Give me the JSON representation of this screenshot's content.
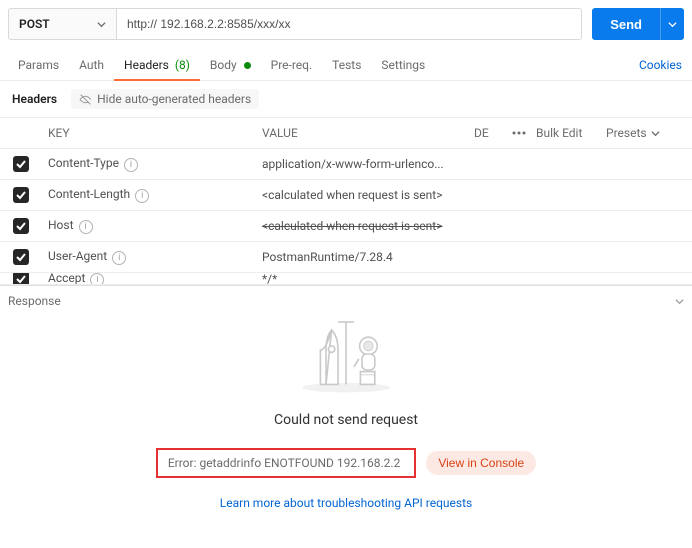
{
  "request": {
    "method": "POST",
    "url": "http:// 192.168.2.2:8585/xxx/xx",
    "sendLabel": "Send"
  },
  "tabs": {
    "params": "Params",
    "auth": "Auth",
    "headers": "Headers",
    "headersCount": "(8)",
    "body": "Body",
    "prereq": "Pre-req.",
    "tests": "Tests",
    "settings": "Settings",
    "cookies": "Cookies"
  },
  "sub": {
    "title": "Headers",
    "hide": "Hide auto-generated headers"
  },
  "tableHead": {
    "key": "KEY",
    "value": "VALUE",
    "desc": "DE",
    "bulkEdit": "Bulk Edit",
    "presets": "Presets"
  },
  "rows": [
    {
      "key": "Content-Type",
      "value": "application/x-www-form-urlenco...",
      "info": true,
      "strike": false
    },
    {
      "key": "Content-Length",
      "value": "<calculated when request is sent>",
      "info": true,
      "strike": false
    },
    {
      "key": "Host",
      "value": "<calculated when request is sent>",
      "info": true,
      "strike": true
    },
    {
      "key": "User-Agent",
      "value": "PostmanRuntime/7.28.4",
      "info": true,
      "strike": false
    },
    {
      "key": "Accept",
      "value": "*/*",
      "info": true,
      "strike": false
    }
  ],
  "response": {
    "label": "Response",
    "title": "Could not send request",
    "errorPrefix": "Error: getaddrinfo ENOTFOUND",
    "errorHost": " 192.168.2.2",
    "consoleLabel": "View in Console",
    "learn": "Learn more about troubleshooting API requests"
  }
}
